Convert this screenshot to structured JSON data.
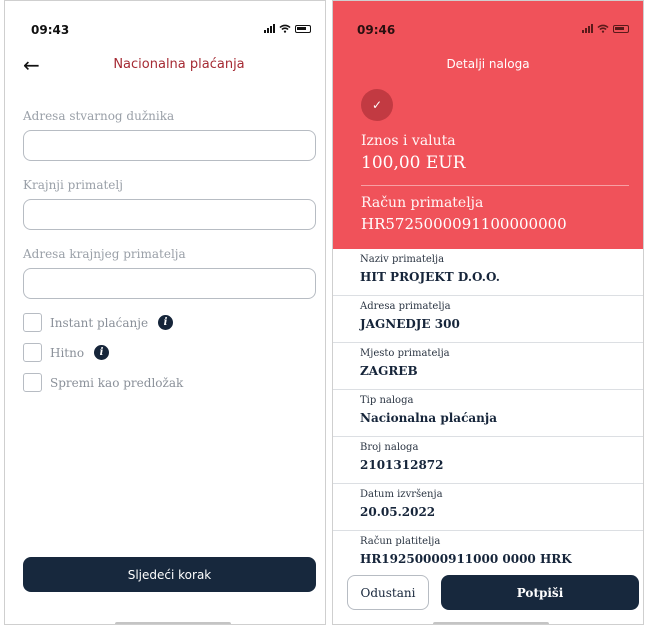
{
  "left_screen": {
    "status_time": "09:43",
    "title": "Nacionalna plaćanja",
    "fields": [
      {
        "label": "Adresa stvarnog dužnika",
        "value": ""
      },
      {
        "label": "Krajnji primatelj",
        "value": ""
      },
      {
        "label": "Adresa krajnjeg primatelja",
        "value": ""
      }
    ],
    "checkboxes": [
      {
        "label": "Instant plaćanje",
        "checked": false,
        "has_info_icon": true
      },
      {
        "label": "Hitno",
        "checked": false,
        "has_info_icon": true
      },
      {
        "label": "Spremi kao predložak",
        "checked": false,
        "has_info_icon": false
      }
    ],
    "next_button_label": "Sljedeći korak",
    "info_icon_glyph": "i"
  },
  "right_screen": {
    "status_time": "09:46",
    "title": "Detalji naloga",
    "header_color": "#f0525a",
    "amount_label": "Iznos i valuta",
    "amount_value": "100,00 EUR",
    "account_label": "Račun primatelja",
    "account_value": "HR5725000091100000000",
    "details": [
      {
        "label": "Naziv primatelja",
        "value": "HIT PROJEKT D.O.O."
      },
      {
        "label": "Adresa primatelja",
        "value": "JAGNEDJE 300"
      },
      {
        "label": "Mjesto primatelja",
        "value": "ZAGREB"
      },
      {
        "label": "Tip naloga",
        "value": "Nacionalna plaćanja"
      },
      {
        "label": "Broj naloga",
        "value": "2101312872"
      },
      {
        "label": "Datum izvršenja",
        "value": "20.05.2022"
      },
      {
        "label": "Račun platitelja",
        "value": "HR19250000911000 0000 HRK"
      }
    ],
    "cancel_button_label": "Odustani",
    "sign_button_label": "Potpiši"
  },
  "icons": {
    "back": "arrow-left-icon",
    "check": "checkmark-icon",
    "info": "info-icon",
    "signal": "signal-icon",
    "wifi": "wifi-icon",
    "battery": "battery-icon"
  },
  "colors": {
    "accent_red": "#f0525a",
    "title_red": "#a52a33",
    "navy": "#17283d"
  }
}
